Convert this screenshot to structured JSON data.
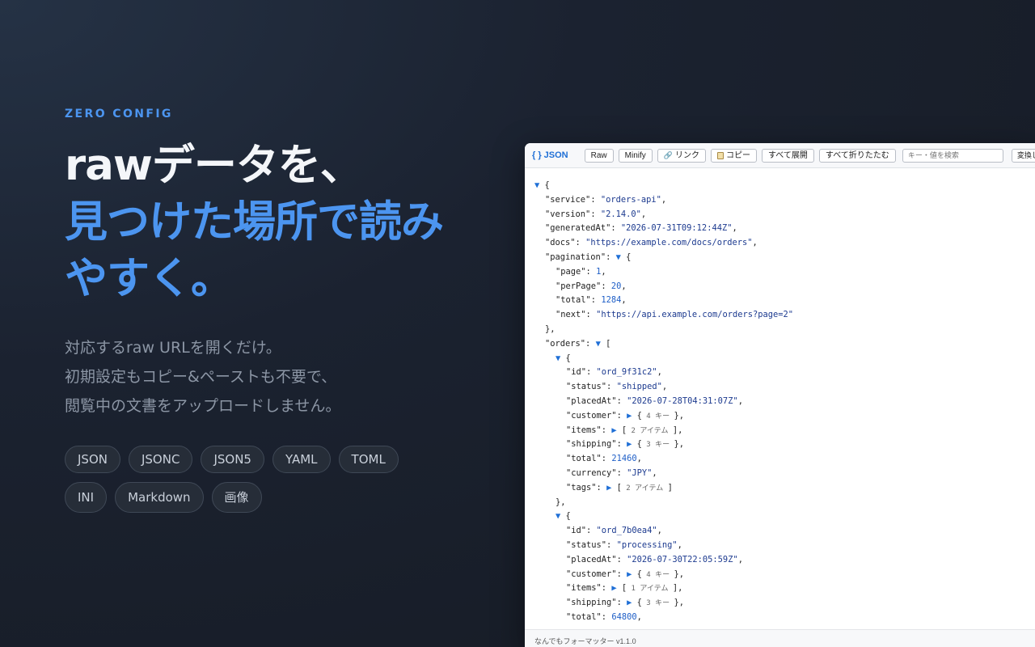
{
  "hero": {
    "eyebrow": "ZERO CONFIG",
    "headline": [
      "rawデータを、",
      "見つけた場所で読み",
      "やすく。"
    ],
    "description": [
      "対応するraw URLを開くだけ。",
      "初期設定もコピー&ペーストも不要で、",
      "閲覧中の文書をアップロードしません。"
    ],
    "formats": [
      "JSON",
      "JSONC",
      "JSON5",
      "YAML",
      "TOML",
      "INI",
      "Markdown",
      "画像"
    ]
  },
  "viewer": {
    "brand": "{ } JSON",
    "toolbar": {
      "raw": "Raw",
      "minify": "Minify",
      "link": "リンク",
      "copy": "コピー",
      "expand_all": "すべて展開",
      "collapse_all": "すべて折りたたむ",
      "search_placeholder": "キー・値を検索",
      "convert_select": "変換しない"
    },
    "status": "なんでもフォーマッター v1.1.0",
    "lines": [
      {
        "indent": 0,
        "toggle": "▼",
        "key": "",
        "punct": "{"
      },
      {
        "indent": 1,
        "key": "\"service\"",
        "str": "\"orders-api\"",
        "end": ","
      },
      {
        "indent": 1,
        "key": "\"version\"",
        "str": "\"2.14.0\"",
        "end": ","
      },
      {
        "indent": 1,
        "key": "\"generatedAt\"",
        "str": "\"2026-07-31T09:12:44Z\"",
        "end": ","
      },
      {
        "indent": 1,
        "key": "\"docs\"",
        "str": "\"https://example.com/docs/orders\"",
        "end": ","
      },
      {
        "indent": 1,
        "key": "\"pagination\"",
        "toggle": "▼",
        "punct": "{"
      },
      {
        "indent": 2,
        "key": "\"page\"",
        "num": "1",
        "end": ","
      },
      {
        "indent": 2,
        "key": "\"perPage\"",
        "num": "20",
        "end": ","
      },
      {
        "indent": 2,
        "key": "\"total\"",
        "num": "1284",
        "end": ","
      },
      {
        "indent": 2,
        "key": "\"next\"",
        "str": "\"https://api.example.com/orders?page=2\""
      },
      {
        "indent": 1,
        "punct": "},"
      },
      {
        "indent": 1,
        "key": "\"orders\"",
        "toggle": "▼",
        "punct": "["
      },
      {
        "indent": 2,
        "toggle": "▼",
        "key": "",
        "punct": "{"
      },
      {
        "indent": 3,
        "key": "\"id\"",
        "str": "\"ord_9f31c2\"",
        "end": ","
      },
      {
        "indent": 3,
        "key": "\"status\"",
        "str": "\"shipped\"",
        "end": ","
      },
      {
        "indent": 3,
        "key": "\"placedAt\"",
        "str": "\"2026-07-28T04:31:07Z\"",
        "end": ","
      },
      {
        "indent": 3,
        "key": "\"customer\"",
        "toggle": "▶",
        "punct": "{",
        "meta": "4 キー",
        "close": "},"
      },
      {
        "indent": 3,
        "key": "\"items\"",
        "toggle": "▶",
        "punct": "[",
        "meta": "2 アイテム",
        "close": "],"
      },
      {
        "indent": 3,
        "key": "\"shipping\"",
        "toggle": "▶",
        "punct": "{",
        "meta": "3 キー",
        "close": "},"
      },
      {
        "indent": 3,
        "key": "\"total\"",
        "num": "21460",
        "end": ","
      },
      {
        "indent": 3,
        "key": "\"currency\"",
        "str": "\"JPY\"",
        "end": ","
      },
      {
        "indent": 3,
        "key": "\"tags\"",
        "toggle": "▶",
        "punct": "[",
        "meta": "2 アイテム",
        "close": "]"
      },
      {
        "indent": 2,
        "punct": "},"
      },
      {
        "indent": 2,
        "toggle": "▼",
        "key": "",
        "punct": "{"
      },
      {
        "indent": 3,
        "key": "\"id\"",
        "str": "\"ord_7b0ea4\"",
        "end": ","
      },
      {
        "indent": 3,
        "key": "\"status\"",
        "str": "\"processing\"",
        "end": ","
      },
      {
        "indent": 3,
        "key": "\"placedAt\"",
        "str": "\"2026-07-30T22:05:59Z\"",
        "end": ","
      },
      {
        "indent": 3,
        "key": "\"customer\"",
        "toggle": "▶",
        "punct": "{",
        "meta": "4 キー",
        "close": "},"
      },
      {
        "indent": 3,
        "key": "\"items\"",
        "toggle": "▶",
        "punct": "[",
        "meta": "1 アイテム",
        "close": "],"
      },
      {
        "indent": 3,
        "key": "\"shipping\"",
        "toggle": "▶",
        "punct": "{",
        "meta": "3 キー",
        "close": "},"
      },
      {
        "indent": 3,
        "key": "\"total\"",
        "num": "64800",
        "end": ","
      }
    ]
  }
}
